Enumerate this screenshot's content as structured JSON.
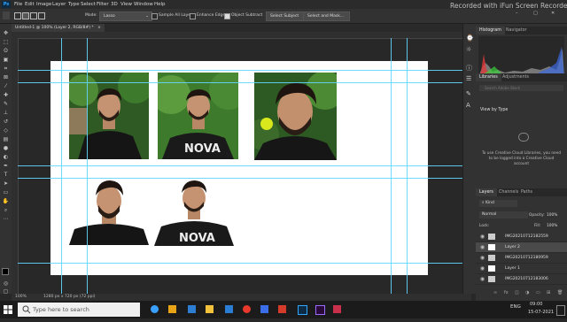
{
  "watermark": "Recorded with iFun Screen Recorder",
  "menu": {
    "app_icon": "Ps",
    "items": [
      "File",
      "Edit",
      "Image",
      "Layer",
      "Type",
      "Select",
      "Filter",
      "3D",
      "View",
      "Window",
      "Help"
    ]
  },
  "window_controls": {
    "minimize": "–",
    "restore": "□",
    "close": "✕"
  },
  "options_bar": {
    "mode_label": "Mode:",
    "mode_value": "Lasso",
    "sample_all_layers": "Sample All Layers",
    "enhance_edge": "Enhance Edge",
    "object_subtract": "Object Subtract",
    "select_subject": "Select Subject",
    "select_and_mask": "Select and Mask..."
  },
  "document_tab": {
    "title": "Untitled-1 @ 100% (Layer 2, RGB/8#) *",
    "close": "×"
  },
  "status_bar": {
    "zoom": "100%",
    "doc_size": "1280 px x 720 px (72 ppi)"
  },
  "panels": {
    "histogram_tabs": [
      "Histogram",
      "Navigator"
    ],
    "libraries_tabs": [
      "Libraries",
      "Adjustments"
    ],
    "library_search_placeholder": "Search Adobe Stock",
    "view_by": "View by Type",
    "cc_message": "To use Creative Cloud Libraries, you need to be logged into a Creative Cloud account",
    "layers_tabs": [
      "Layers",
      "Channels",
      "Paths"
    ],
    "kind_label": "Kind",
    "blend_mode": "Normal",
    "opacity_label": "Opacity:",
    "opacity_value": "100%",
    "lock_label": "Lock:",
    "fill_label": "Fill:",
    "fill_value": "100%",
    "layers": [
      {
        "name": "IMG20210712182559",
        "selected": false
      },
      {
        "name": "Layer 2",
        "selected": true
      },
      {
        "name": "IMG20210712180959",
        "selected": false
      },
      {
        "name": "Layer 1",
        "selected": false
      },
      {
        "name": "IMG20210712183006",
        "selected": false
      }
    ]
  },
  "taskbar": {
    "search_placeholder": "Type here to search",
    "language": "ENG",
    "time": "09:00",
    "date": "15-07-2021"
  },
  "colors": {
    "guide": "#63d6ff",
    "app_bg": "#282828",
    "panel_bg": "#323232",
    "ps_blue": "#31a8ff"
  }
}
